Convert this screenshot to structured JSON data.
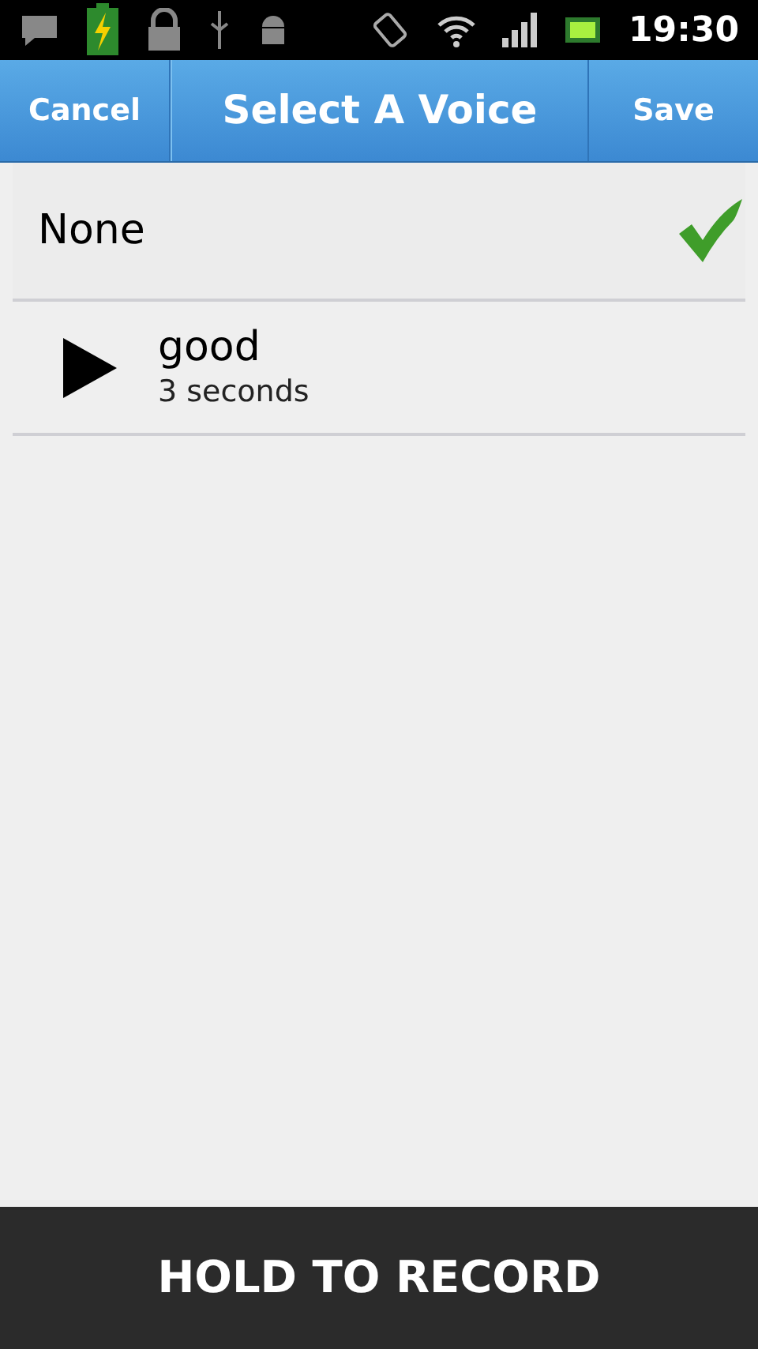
{
  "status_bar": {
    "time": "19:30"
  },
  "header": {
    "cancel": "Cancel",
    "title": "Select A Voice",
    "save": "Save"
  },
  "voices": [
    {
      "kind": "none",
      "label": "None",
      "selected": true
    },
    {
      "kind": "recording",
      "label": "good",
      "duration": "3 seconds",
      "selected": false
    }
  ],
  "record_button": "HOLD TO RECORD"
}
